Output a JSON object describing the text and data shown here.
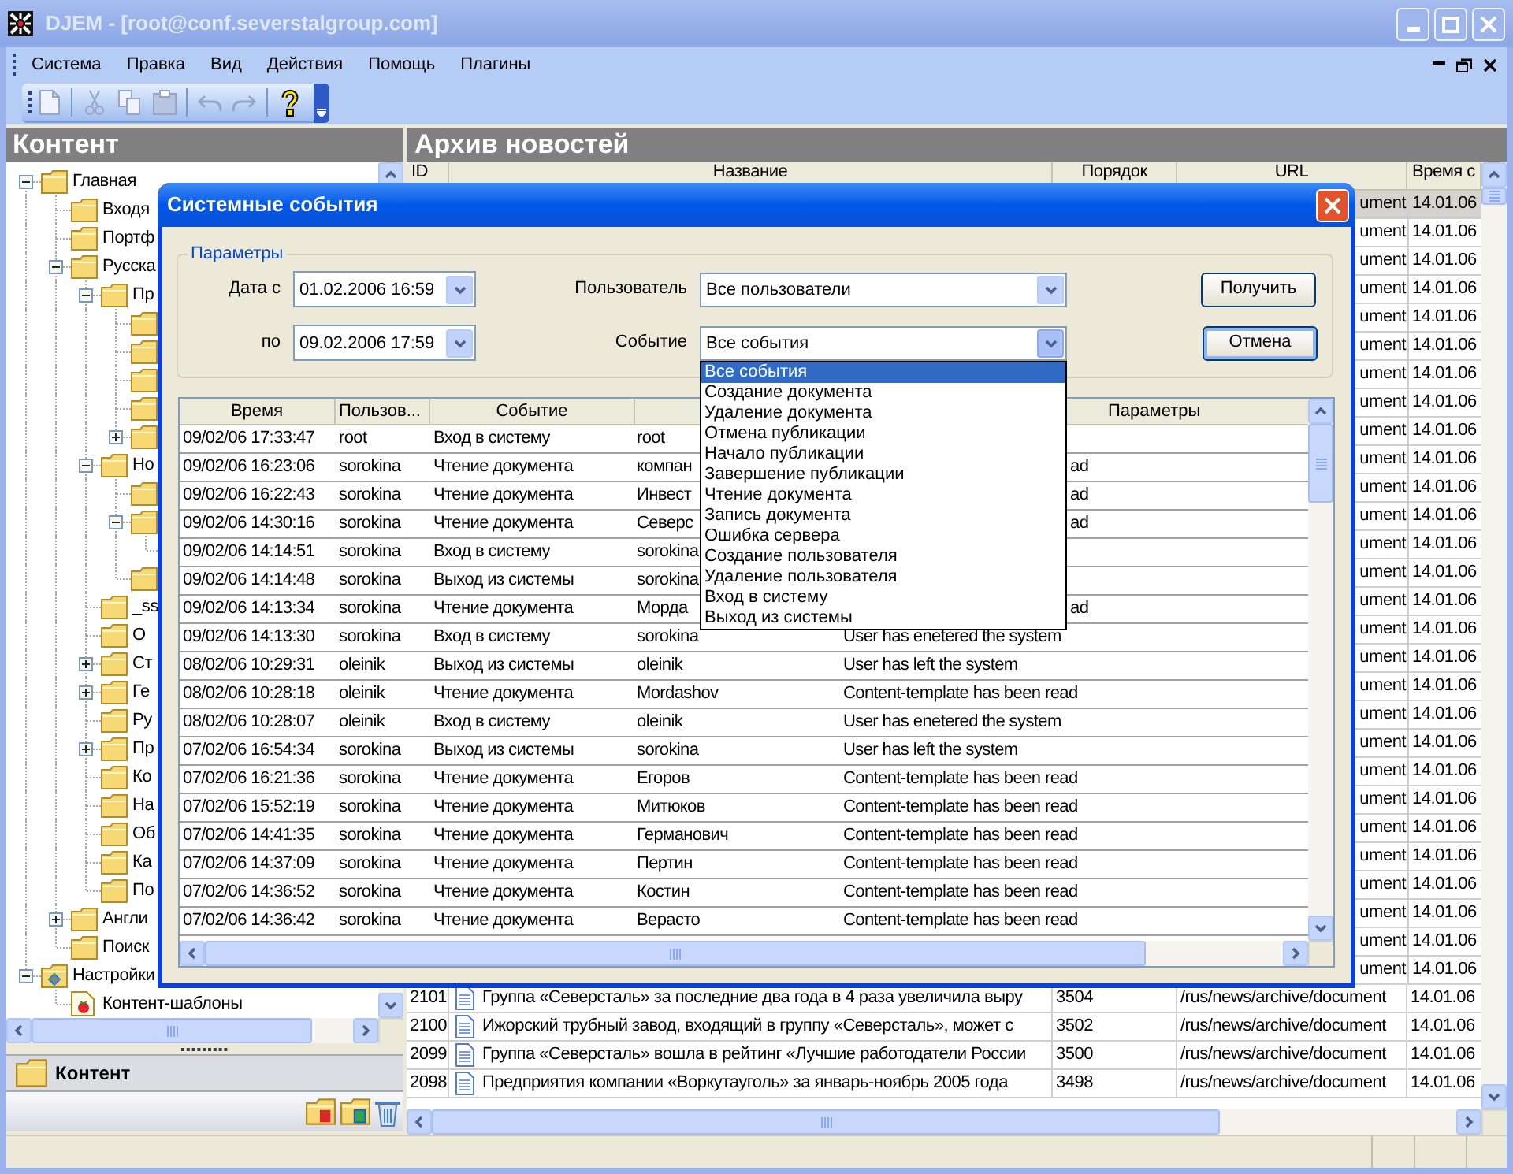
{
  "window": {
    "title": "DJEM - [root@conf.severstalgroup.com]",
    "active": false
  },
  "menu": [
    "Система",
    "Правка",
    "Вид",
    "Действия",
    "Помощь",
    "Плагины"
  ],
  "toolbar": [
    {
      "kind": "new",
      "disabled": true
    },
    {
      "kind": "separator"
    },
    {
      "kind": "cut",
      "disabled": true
    },
    {
      "kind": "copy",
      "disabled": true
    },
    {
      "kind": "paste",
      "disabled": true
    },
    {
      "kind": "separator"
    },
    {
      "kind": "undo",
      "disabled": true
    },
    {
      "kind": "redo",
      "disabled": true
    },
    {
      "kind": "separator"
    },
    {
      "kind": "help",
      "disabled": false
    }
  ],
  "content_panel": {
    "title": "Контент",
    "tree": [
      {
        "label": "Главная",
        "kind": "folder",
        "expanded": true,
        "children": [
          {
            "label": "Входя",
            "kind": "folder"
          },
          {
            "label": "Портф",
            "kind": "folder"
          },
          {
            "label": "Русска",
            "kind": "folder",
            "expanded": true,
            "children": [
              {
                "label": "Пр",
                "kind": "folder",
                "expanded": true,
                "children": [
                  {
                    "kind": "folder"
                  },
                  {
                    "kind": "folder"
                  },
                  {
                    "kind": "folder"
                  },
                  {
                    "kind": "folder"
                  },
                  {
                    "kind": "folder",
                    "expanded": false
                  }
                ]
              },
              {
                "label": "Но",
                "kind": "folder",
                "expanded": true,
                "children": [
                  {
                    "kind": "folder"
                  },
                  {
                    "kind": "folder",
                    "expanded": true,
                    "children": [
                      {
                        "kind": "stub"
                      }
                    ]
                  },
                  {
                    "kind": "folder"
                  }
                ]
              },
              {
                "label": "_ss",
                "kind": "folder"
              },
              {
                "label": "О",
                "kind": "folder"
              },
              {
                "label": "Ст",
                "kind": "folder",
                "expanded": false
              },
              {
                "label": "Ге",
                "kind": "folder",
                "expanded": false
              },
              {
                "label": "Ру",
                "kind": "folder"
              },
              {
                "label": "Пр",
                "kind": "folder",
                "expanded": false
              },
              {
                "label": "Ко",
                "kind": "folder"
              },
              {
                "label": "На",
                "kind": "folder"
              },
              {
                "label": "Об",
                "kind": "folder"
              },
              {
                "label": "Ка",
                "kind": "folder"
              },
              {
                "label": "По",
                "kind": "folder"
              }
            ]
          },
          {
            "label": "Англи",
            "kind": "folder",
            "expanded": false
          },
          {
            "label": "Поиск",
            "kind": "folder"
          }
        ]
      },
      {
        "label": "Настройки",
        "kind": "settings",
        "expanded": true,
        "children": [
          {
            "label": "Контент-шаблоны",
            "kind": "template"
          }
        ]
      }
    ],
    "section_button": "Контент"
  },
  "archive": {
    "title": "Архив новостей",
    "columns": [
      "ID",
      "Название",
      "Порядок",
      "URL",
      "Время с"
    ],
    "rows": [
      {
        "url": "ument",
        "time": "14.01.06",
        "selected": true
      },
      {
        "url": "ument",
        "time": "14.01.06",
        "selected": false
      },
      {
        "url": "ument",
        "time": "14.01.06",
        "selected": false
      },
      {
        "url": "ument",
        "time": "14.01.06",
        "selected": false
      },
      {
        "url": "ument",
        "time": "14.01.06",
        "selected": false
      },
      {
        "url": "ument",
        "time": "14.01.06",
        "selected": false
      },
      {
        "url": "ument",
        "time": "14.01.06",
        "selected": false
      },
      {
        "url": "ument",
        "time": "14.01.06",
        "selected": false
      },
      {
        "url": "ument",
        "time": "14.01.06",
        "selected": false
      },
      {
        "url": "ument",
        "time": "14.01.06",
        "selected": false
      },
      {
        "url": "ument",
        "time": "14.01.06",
        "selected": false
      },
      {
        "url": "ument",
        "time": "14.01.06",
        "selected": false
      },
      {
        "url": "ument",
        "time": "14.01.06",
        "selected": false
      },
      {
        "url": "ument",
        "time": "14.01.06",
        "selected": false
      },
      {
        "url": "ument",
        "time": "14.01.06",
        "selected": false
      },
      {
        "url": "ument",
        "time": "14.01.06",
        "selected": false
      },
      {
        "url": "ument",
        "time": "14.01.06",
        "selected": false
      },
      {
        "url": "ument",
        "time": "14.01.06",
        "selected": false
      },
      {
        "url": "ument",
        "time": "14.01.06",
        "selected": false
      },
      {
        "url": "ument",
        "time": "14.01.06",
        "selected": false
      },
      {
        "url": "ument",
        "time": "14.01.06",
        "selected": false
      },
      {
        "url": "ument",
        "time": "14.01.06",
        "selected": false
      },
      {
        "url": "ument",
        "time": "14.01.06",
        "selected": false
      },
      {
        "url": "ument",
        "time": "14.01.06",
        "selected": false
      },
      {
        "url": "ument",
        "time": "14.01.06",
        "selected": false
      },
      {
        "url": "ument",
        "time": "14.01.06",
        "selected": false
      },
      {
        "url": "ument",
        "time": "14.01.06",
        "selected": false
      },
      {
        "url": "ument",
        "time": "14.01.06",
        "selected": false
      },
      {
        "id": "2101",
        "title": "Группа «Северсталь» за последние два года в 4 раза увеличила выру",
        "order": "3504",
        "url": "/rus/news/archive/document",
        "time": "14.01.06",
        "selected": false
      },
      {
        "id": "2100",
        "title": "Ижорский трубный завод, входящий в группу «Северсталь», может с",
        "order": "3502",
        "url": "/rus/news/archive/document",
        "time": "14.01.06",
        "selected": false
      },
      {
        "id": "2099",
        "title": "Группа «Северсталь» вошла в рейтинг «Лучшие работодатели России",
        "order": "3500",
        "url": "/rus/news/archive/document",
        "time": "14.01.06",
        "selected": false
      },
      {
        "id": "2098",
        "title": "Предприятия компании «Воркутауголь» за январь-ноябрь 2005 года",
        "order": "3498",
        "url": "/rus/news/archive/document",
        "time": "14.01.06",
        "selected": false
      }
    ]
  },
  "dialog": {
    "title": "Системные события",
    "group_title": "Параметры",
    "date_from": {
      "label": "Дата с",
      "value": "01.02.2006 16:59"
    },
    "date_to": {
      "label": "по",
      "value": "09.02.2006 17:59"
    },
    "user": {
      "label": "Пользователь",
      "value": "Все пользователи"
    },
    "event": {
      "label": "Событие",
      "value": "Все события",
      "expanded": true,
      "options": [
        {
          "label": "Все события",
          "selected": true
        },
        {
          "label": "Создание документа",
          "selected": false
        },
        {
          "label": "Удаление документа",
          "selected": false
        },
        {
          "label": "Отмена публикации",
          "selected": false
        },
        {
          "label": "Начало публикации",
          "selected": false
        },
        {
          "label": "Завершение публикации",
          "selected": false
        },
        {
          "label": "Чтение документа",
          "selected": false
        },
        {
          "label": "Запись документа",
          "selected": false
        },
        {
          "label": "Ошибка сервера",
          "selected": false
        },
        {
          "label": "Создание пользователя",
          "selected": false
        },
        {
          "label": "Удаление пользователя",
          "selected": false
        },
        {
          "label": "Вход в систему",
          "selected": false
        },
        {
          "label": "Выход из системы",
          "selected": false
        }
      ]
    },
    "buttons": [
      {
        "label": "Получить",
        "default": false
      },
      {
        "label": "Отмена",
        "default": true
      }
    ],
    "columns": {
      "time": "Время",
      "user": "Пользов...",
      "event": "Событие",
      "params": "Параметры"
    },
    "rows": [
      {
        "time": "09/02/06 17:33:47",
        "user": "root",
        "event": "Вход в систему",
        "column_4": "root"
      },
      {
        "time": "09/02/06 16:23:06",
        "user": "sorokina",
        "event": "Чтение документа",
        "column_4": "компан",
        "params": "ad"
      },
      {
        "time": "09/02/06 16:22:43",
        "user": "sorokina",
        "event": "Чтение документа",
        "column_4": "Инвест",
        "params": "ad"
      },
      {
        "time": "09/02/06 14:30:16",
        "user": "sorokina",
        "event": "Чтение документа",
        "column_4": "Северс",
        "params": "ad"
      },
      {
        "time": "09/02/06 14:14:51",
        "user": "sorokina",
        "event": "Вход в систему",
        "column_4": "sorokina"
      },
      {
        "time": "09/02/06 14:14:48",
        "user": "sorokina",
        "event": "Выход из системы",
        "column_4": "sorokina"
      },
      {
        "time": "09/02/06 14:13:34",
        "user": "sorokina",
        "event": "Чтение документа",
        "column_4": "Морда",
        "params": "ad"
      },
      {
        "time": "09/02/06 14:13:30",
        "user": "sorokina",
        "event": "Вход в систему",
        "column_4": "sorokina",
        "params": "User has enetered the system"
      },
      {
        "time": "08/02/06 10:29:31",
        "user": "oleinik",
        "event": "Выход из системы",
        "column_4": "oleinik",
        "params": "User has left the system"
      },
      {
        "time": "08/02/06 10:28:18",
        "user": "oleinik",
        "event": "Чтение документа",
        "column_4": "Mordashov",
        "params": "Content-template has been read"
      },
      {
        "time": "08/02/06 10:28:07",
        "user": "oleinik",
        "event": "Вход в систему",
        "column_4": "oleinik",
        "params": "User has enetered the system"
      },
      {
        "time": "07/02/06 16:54:34",
        "user": "sorokina",
        "event": "Выход из системы",
        "column_4": "sorokina",
        "params": "User has left the system"
      },
      {
        "time": "07/02/06 16:21:36",
        "user": "sorokina",
        "event": "Чтение документа",
        "column_4": "Егоров",
        "params": "Content-template has been read"
      },
      {
        "time": "07/02/06 15:52:19",
        "user": "sorokina",
        "event": "Чтение документа",
        "column_4": "Митюков",
        "params": "Content-template has been read"
      },
      {
        "time": "07/02/06 14:41:35",
        "user": "sorokina",
        "event": "Чтение документа",
        "column_4": "Германович",
        "params": "Content-template has been read"
      },
      {
        "time": "07/02/06 14:37:09",
        "user": "sorokina",
        "event": "Чтение документа",
        "column_4": "Пертин",
        "params": "Content-template has been read"
      },
      {
        "time": "07/02/06 14:36:52",
        "user": "sorokina",
        "event": "Чтение документа",
        "column_4": "Костин",
        "params": "Content-template has been read"
      },
      {
        "time": "07/02/06 14:36:42",
        "user": "sorokina",
        "event": "Чтение документа",
        "column_4": "Верасто",
        "params": "Content-template has been read"
      }
    ]
  }
}
